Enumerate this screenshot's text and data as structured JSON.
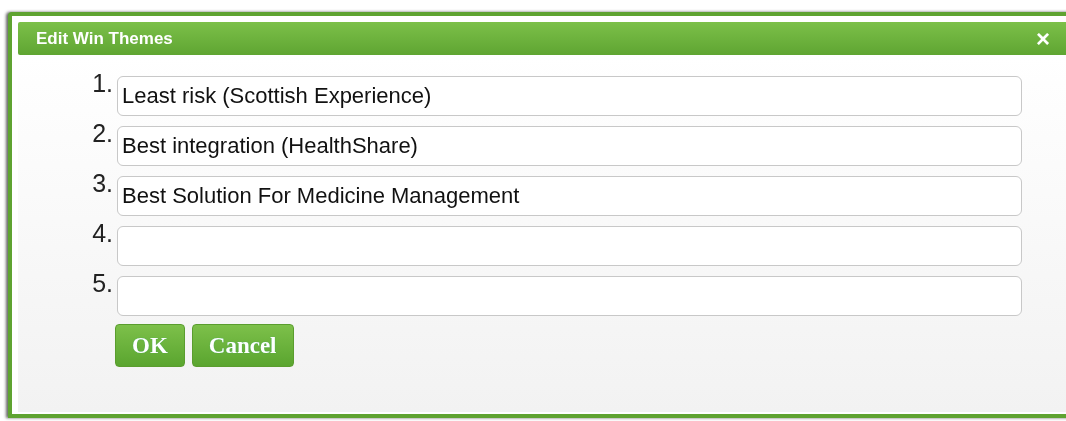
{
  "dialog": {
    "title": "Edit Win Themes",
    "close": "×"
  },
  "themes": [
    {
      "number": "1.",
      "value": "Least risk (Scottish Experience)"
    },
    {
      "number": "2.",
      "value": "Best integration (HealthShare)"
    },
    {
      "number": "3.",
      "value": "Best Solution For Medicine Management"
    },
    {
      "number": "4."
    },
    {
      "number": "5."
    }
  ],
  "buttons": [
    "OK",
    "Cancel"
  ]
}
